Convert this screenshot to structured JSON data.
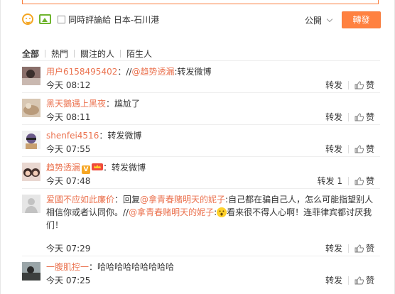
{
  "compose": {
    "sync_label": "同時評論給 日本-石川港",
    "privacy": "公開",
    "forward_button": "轉發"
  },
  "tabs": [
    "全部",
    "熱門",
    "關注的人",
    "陌生人"
  ],
  "comments": [
    {
      "user": "用户6158495402",
      "text_prefix": "：//",
      "mention": "@趋势透漏",
      "text": ":转发微博",
      "time": "今天 08:12",
      "repost": "转发",
      "like": "赞"
    },
    {
      "user": "黑天鵝遇上黑夜",
      "text": "：尴尬了",
      "time": "今天 08:11",
      "repost": "转发",
      "like": "赞"
    },
    {
      "user": "shenfei4516",
      "text": "：转发微博",
      "time": "今天 07:55",
      "repost": "转发",
      "like": "赞"
    },
    {
      "user": "趋势透漏",
      "badge": "V",
      "text": "：转发微博",
      "time": "今天 07:48",
      "repost": "转发 1",
      "like": "赞"
    },
    {
      "user": "爱國不应如此廉价",
      "text_a": "：回复",
      "mention_a": "@拿青春赌明天的妮子",
      "text_b": ":自己都在骗自己人，怎么可能指望别人相信你或者认同你。//",
      "mention_b": "@拿青春赌明天的妮子",
      "text_c": ":",
      "text_d": "看来很不得人心啊！连菲律宾都讨厌我们！",
      "time": "今天 07:29",
      "repost": "转发",
      "like": "赞"
    },
    {
      "user": "一腹肌控一",
      "text": "：哈哈哈哈哈哈哈哈哈",
      "time": "今天 07:25",
      "repost": "转发",
      "like": "赞"
    }
  ],
  "colors": {
    "accent": "#eb7350",
    "button": "#ff8140"
  }
}
